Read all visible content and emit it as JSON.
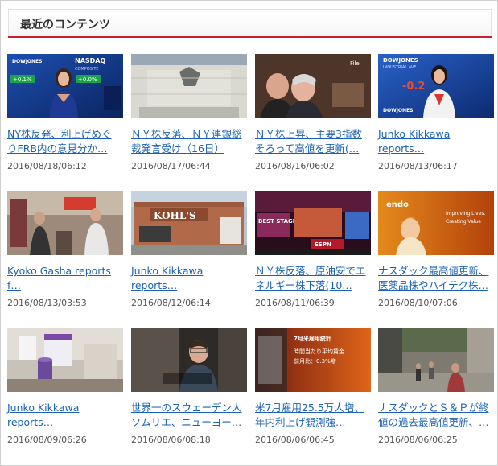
{
  "section": {
    "title": "最近のコンテンツ"
  },
  "items": [
    {
      "title": "NY株反発、利上げめぐ\nりFRB内の意見分か…",
      "date": "2016/08/18/06:12",
      "thumb_icon": "news-anchor-nasdaq-thumbnail"
    },
    {
      "title": "ＮＹ株反落、ＮＹ連銀総\n裁発言受け（16日）",
      "date": "2016/08/17/06:44",
      "thumb_icon": "federal-reserve-building-thumbnail"
    },
    {
      "title": "ＮＹ株上昇、主要3指数\nそろって高値を更新(…",
      "date": "2016/08/16/06:02",
      "thumb_icon": "fed-officials-thumbnail"
    },
    {
      "title": "Junko Kikkawa\nreports…",
      "date": "2016/08/13/06:17",
      "thumb_icon": "news-anchor-dowjones-thumbnail"
    },
    {
      "title": "Kyoko Gasha reports\nf…",
      "date": "2016/08/13/03:53",
      "thumb_icon": "street-shoppers-thumbnail"
    },
    {
      "title": "Junko Kikkawa\nreports…",
      "date": "2016/08/12/06:14",
      "thumb_icon": "kohls-store-thumbnail"
    },
    {
      "title": "ＮＹ株反落、原油安でエ\nネルギー株下落(10…",
      "date": "2016/08/11/06:39",
      "thumb_icon": "times-square-thumbnail"
    },
    {
      "title": "ナスダック最高値更新、\n医薬品株やハイテク株…",
      "date": "2016/08/10/07:06",
      "thumb_icon": "endo-pharma-thumbnail"
    },
    {
      "title": "Junko Kikkawa\nreports…",
      "date": "2016/08/09/06:26",
      "thumb_icon": "pharmacy-products-thumbnail"
    },
    {
      "title": "世界一のスウェーデン人\nソムリエ、ニューヨー…",
      "date": "2016/08/06/08:18",
      "thumb_icon": "sommelier-interview-thumbnail"
    },
    {
      "title": "米7月雇用25.5万人増、\n年内利上げ観測強…",
      "date": "2016/08/06/06:45",
      "thumb_icon": "jobs-report-thumbnail"
    },
    {
      "title": "ナスダックとＳ＆Ｐが終\n値の過去最高値更新、…",
      "date": "2016/08/06/06:25",
      "thumb_icon": "city-street-thumbnail"
    }
  ],
  "thumb_text": {
    "nasdaq": "NASDAQ",
    "composite": "COMPOSITE",
    "dowjones": "DOWJONES",
    "industrial": "INDUSTRIAL AVE",
    "plus1": "+0.1%",
    "plus2": "+0.0%",
    "minus": "-0.2",
    "file": "File",
    "kohls": "KOHL'S",
    "endo": "endo",
    "endo_tag1": "Improving Lives.",
    "endo_tag2": "Creating Value",
    "jobs_head": "7月米雇用統計",
    "jobs_line1": "時間当たり平均賃金",
    "jobs_line2": "前月比：0.3%増",
    "best_stage": "BEST STAGE",
    "espn": "ESPN"
  },
  "colors": {
    "accent_red": "#cc1f2d",
    "link_blue": "#1b62b5"
  }
}
